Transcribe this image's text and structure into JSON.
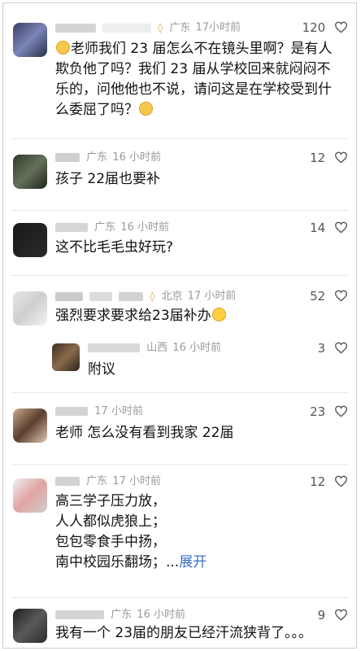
{
  "comments": [
    {
      "region": "广东",
      "time": "17小时前",
      "likes": "120",
      "badge": true,
      "text_parts": [
        "老师我们 23 届怎么不在镜头里啊？是有人欺负他了吗？我们 23 届从学校回来就闷闷不乐的，问他他也不说，请问这是在学校受到什么委屈了吗？"
      ]
    },
    {
      "region": "广东",
      "time": "16 小时前",
      "likes": "12",
      "text_parts": [
        "孩子 22届也要补"
      ]
    },
    {
      "region": "广东",
      "time": "16 小时前",
      "likes": "14",
      "text_parts": [
        "这不比毛毛虫好玩?"
      ]
    },
    {
      "region": "北京",
      "time": "17 小时前",
      "likes": "52",
      "badge": true,
      "text_parts": [
        "强烈要求要求给23届补办"
      ]
    },
    {
      "region": "山西",
      "time": "16 小时前",
      "likes": "3",
      "reply": true,
      "text_parts": [
        "附议"
      ]
    },
    {
      "region": "广东",
      "time": "17 小时前",
      "likes": "23",
      "text_parts": [
        "老师 怎么没有看到我家 22届"
      ]
    },
    {
      "region": "广东",
      "time": "17 小时前",
      "likes": "12",
      "lines": [
        "高三学子压力放，",
        "人人都似虎狼上；",
        "包包零食手中扬，",
        "南中校园乐翻场；..."
      ],
      "expand": "展开"
    },
    {
      "region": "广东",
      "time": "16 小时前",
      "likes": "9",
      "text_parts": [
        "我有一个 23届的朋友已经汗流狭背了。。。"
      ]
    }
  ],
  "colors": {
    "accent_link": "#3b6fc4",
    "meta_gray": "#9a9a9a"
  },
  "icons": [
    "heart-outline-icon",
    "smile-emoji-icon",
    "crying-emoji-icon",
    "badge-icon"
  ]
}
